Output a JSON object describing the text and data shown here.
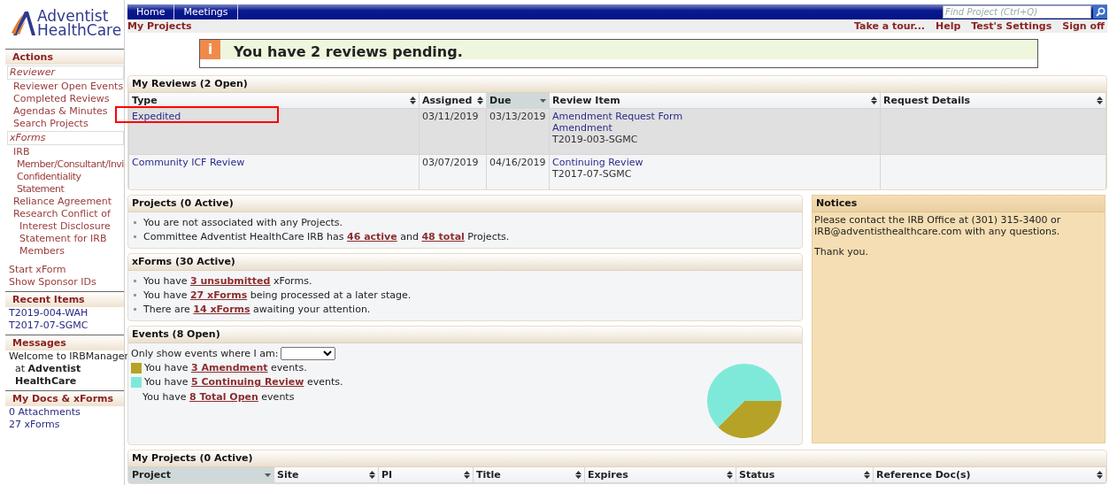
{
  "logo": {
    "line_1": "Adventist",
    "line_2": "HealthCare"
  },
  "sidebar": {
    "sections": [
      {
        "title": "Actions",
        "entries": [
          {
            "kind": "subheader",
            "label": "Reviewer"
          },
          {
            "kind": "link",
            "label": "Reviewer Open Events"
          },
          {
            "kind": "link",
            "label": "Completed Reviews"
          },
          {
            "kind": "link",
            "label": "Agendas & Minutes"
          },
          {
            "kind": "link",
            "label": "Search Projects"
          },
          {
            "kind": "subheader",
            "label": "xForms"
          },
          {
            "kind": "link",
            "label": "IRB"
          },
          {
            "kind": "sublink",
            "lines": [
              "Member/Consultant/Invi",
              "Confidentiality",
              "Statement"
            ]
          },
          {
            "kind": "link",
            "label": "Reliance Agreement"
          },
          {
            "kind": "link",
            "lines": [
              "Research Conflict of",
              "Interest Disclosure",
              "Statement for IRB",
              "Members"
            ]
          },
          {
            "kind": "toplink",
            "label": "Start xForm"
          },
          {
            "kind": "toplink",
            "label": "Show Sponsor IDs"
          }
        ]
      },
      {
        "title": "Recent Items",
        "entries": [
          {
            "kind": "item",
            "label": "T2019-004-WAH"
          },
          {
            "kind": "item",
            "label": "T2017-07-SGMC"
          }
        ]
      },
      {
        "title": "Messages",
        "entries": [
          {
            "kind": "message",
            "lines": [
              "Welcome to IRBManager",
              "at **Adventist**",
              "**HealthCare**"
            ]
          }
        ]
      },
      {
        "title": "My Docs & xForms",
        "entries": [
          {
            "kind": "item",
            "label": "0 Attachments"
          },
          {
            "kind": "item",
            "label": "27 xForms"
          }
        ]
      }
    ]
  },
  "nav": {
    "tabs": [
      {
        "label": "Home",
        "selected": false
      },
      {
        "label": "Meetings",
        "selected": false
      }
    ],
    "search": {
      "placeholder": "Find Project (Ctrl+Q)"
    }
  },
  "breadcrumb": "My Projects",
  "top_links": [
    "Take a tour...",
    "Help",
    "Test's Settings",
    "Sign off"
  ],
  "alert": {
    "icon": "i",
    "message": "You have 2 reviews pending."
  },
  "my_reviews": {
    "title": "My Reviews (2 Open)",
    "columns": [
      {
        "label": "Type",
        "sorted": false
      },
      {
        "label": "Assigned",
        "sorted": false
      },
      {
        "label": "Due",
        "sorted": true
      },
      {
        "label": "Review Item",
        "sorted": false
      },
      {
        "label": "Request Details",
        "sorted": false
      }
    ],
    "rows": [
      {
        "selected": true,
        "annotated": true,
        "type": "Expedited",
        "assigned": "03/11/2019",
        "due": "03/13/2019",
        "review_item": [
          {
            "text": "Amendment Request Form",
            "link": true
          },
          {
            "text": "Amendment",
            "link": true
          },
          {
            "text": "T2019-003-SGMC",
            "link": false
          }
        ]
      },
      {
        "selected": false,
        "annotated": false,
        "type": "Community ICF Review",
        "assigned": "03/07/2019",
        "due": "04/16/2019",
        "review_item": [
          {
            "text": "Continuing Review",
            "link": true
          },
          {
            "text": "T2017-07-SGMC",
            "link": false
          }
        ]
      }
    ]
  },
  "projects": {
    "title": "Projects (0 Active)",
    "bullets": [
      [
        {
          "text": "You are not associated with any Projects."
        }
      ],
      [
        {
          "text": "Committee Adventist HealthCare IRB has "
        },
        {
          "text": "46 active",
          "link": true
        },
        {
          "text": " and "
        },
        {
          "text": "48 total",
          "link": true
        },
        {
          "text": " Projects."
        }
      ]
    ]
  },
  "xforms": {
    "title": "xForms (30 Active)",
    "bullets": [
      [
        {
          "text": "You have "
        },
        {
          "text": "3 unsubmitted",
          "link": true
        },
        {
          "text": " xForms."
        }
      ],
      [
        {
          "text": "You have "
        },
        {
          "text": "27 xForms",
          "link": true
        },
        {
          "text": " being processed at a later stage."
        }
      ],
      [
        {
          "text": "There are "
        },
        {
          "text": "14 xForms",
          "link": true
        },
        {
          "text": " awaiting your attention."
        }
      ]
    ]
  },
  "events": {
    "title": "Events (8 Open)",
    "filter_label": "Only show events where I am:",
    "legend": [
      {
        "color": "#b5a227",
        "segments": [
          {
            "text": "You have "
          },
          {
            "text": "3 Amendment",
            "link": true
          },
          {
            "text": " events."
          }
        ]
      },
      {
        "color": "#7fe9d9",
        "segments": [
          {
            "text": "You have "
          },
          {
            "text": "5 Continuing Review",
            "link": true
          },
          {
            "text": " events."
          }
        ]
      }
    ],
    "total": [
      {
        "text": "You have "
      },
      {
        "text": "8 Total Open",
        "link": true
      },
      {
        "text": " events"
      }
    ],
    "chart_data": {
      "type": "pie",
      "values": [
        37.5,
        62.5
      ]
    }
  },
  "notices": {
    "title": "Notices",
    "paragraphs": [
      "Please contact the IRB Office at (301) 315-3400 or IRB@adventisthealthcare.com with any questions.",
      "Thank you."
    ]
  },
  "my_projects": {
    "title": "My Projects (0 Active)",
    "columns": [
      {
        "label": "Project",
        "sorted": true
      },
      {
        "label": "Site",
        "sorted": false
      },
      {
        "label": "PI",
        "sorted": false
      },
      {
        "label": "Title",
        "sorted": false
      },
      {
        "label": "Expires",
        "sorted": false
      },
      {
        "label": "Status",
        "sorted": false
      },
      {
        "label": "Reference Doc(s)",
        "sorted": false
      }
    ]
  }
}
